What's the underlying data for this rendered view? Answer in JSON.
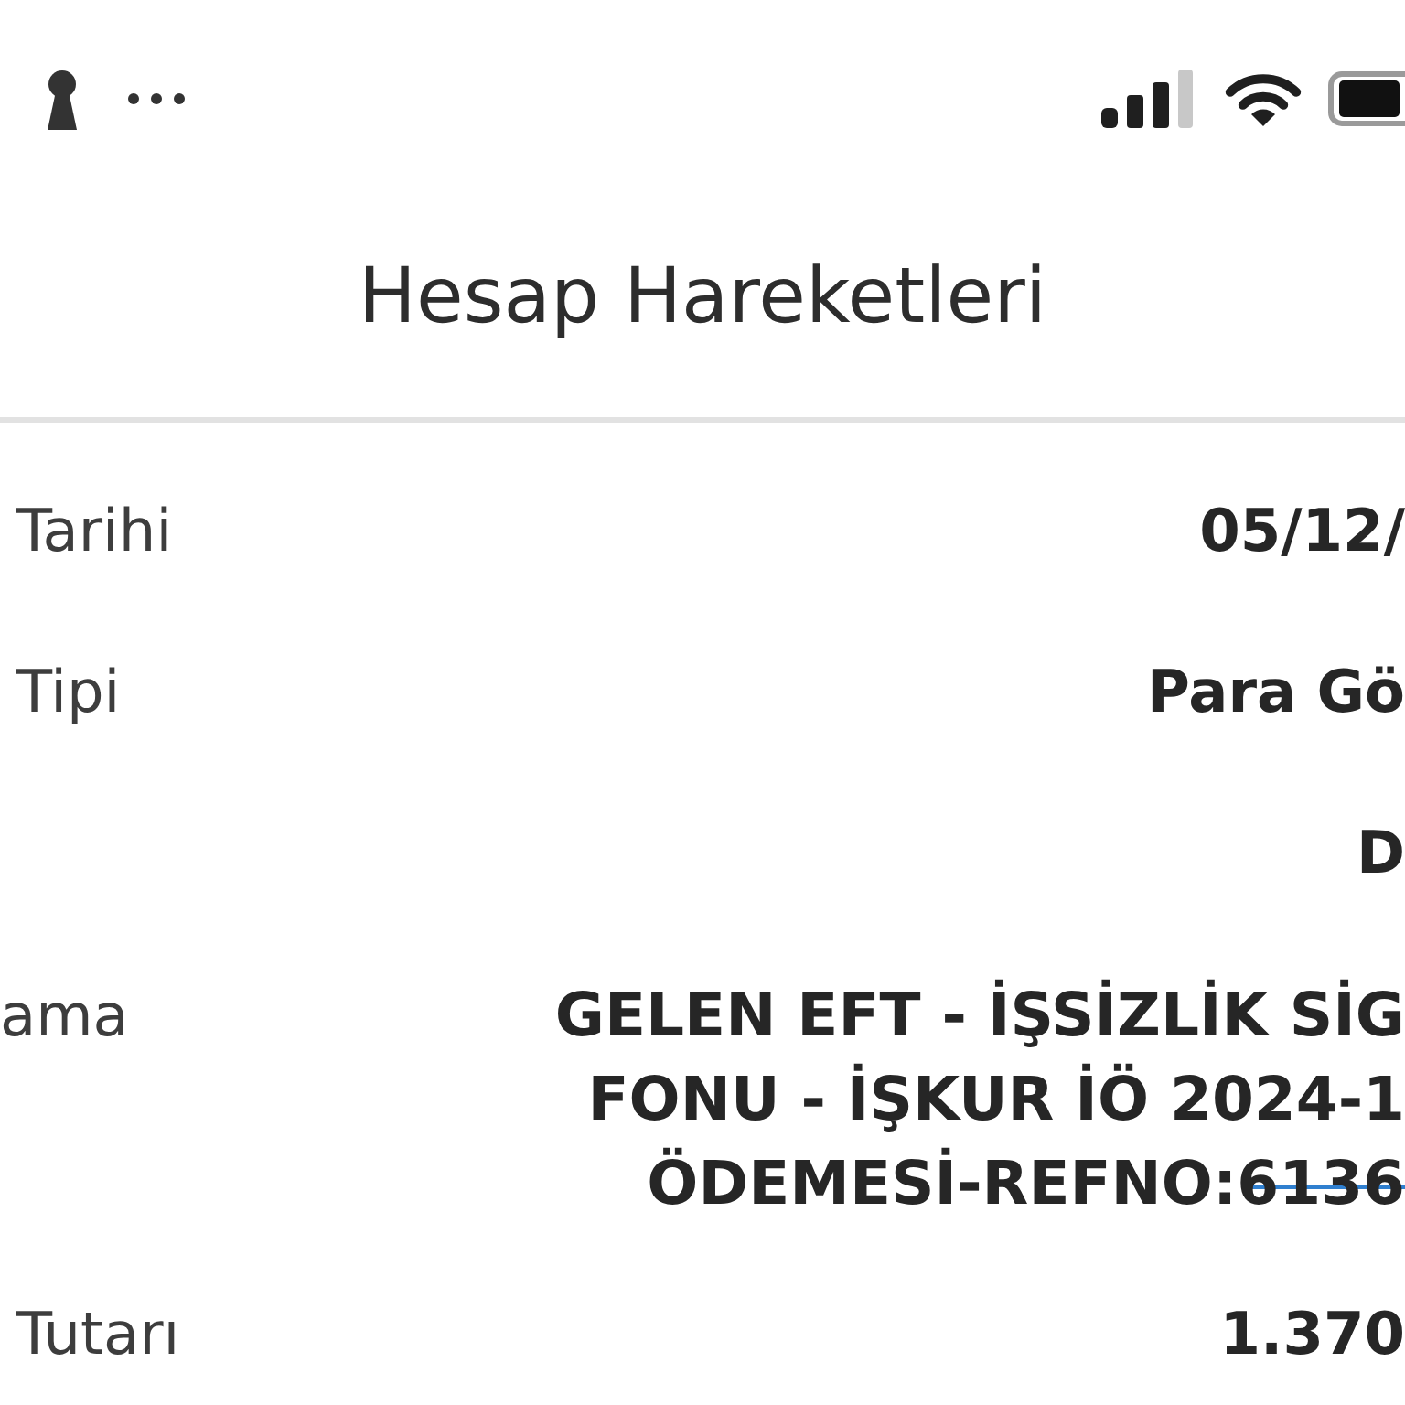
{
  "header": {
    "title": "Hesap Hareketleri"
  },
  "fields": [
    {
      "kind": "single",
      "label": "Tarihi",
      "value": "05/12/"
    },
    {
      "kind": "single",
      "label": "Tipi",
      "value": "Para Gö"
    },
    {
      "kind": "single",
      "value": "D"
    },
    {
      "kind": "multiline",
      "label": "ama",
      "value_lines": [
        "GELEN EFT - İŞSİZLİK SİG",
        "FONU - İŞKUR İÖ 2024-1",
        "ÖDEMESİ-REFNO:6136"
      ],
      "scribbled": true
    },
    {
      "kind": "single",
      "label": "Tutarı",
      "value": "1.370"
    }
  ]
}
